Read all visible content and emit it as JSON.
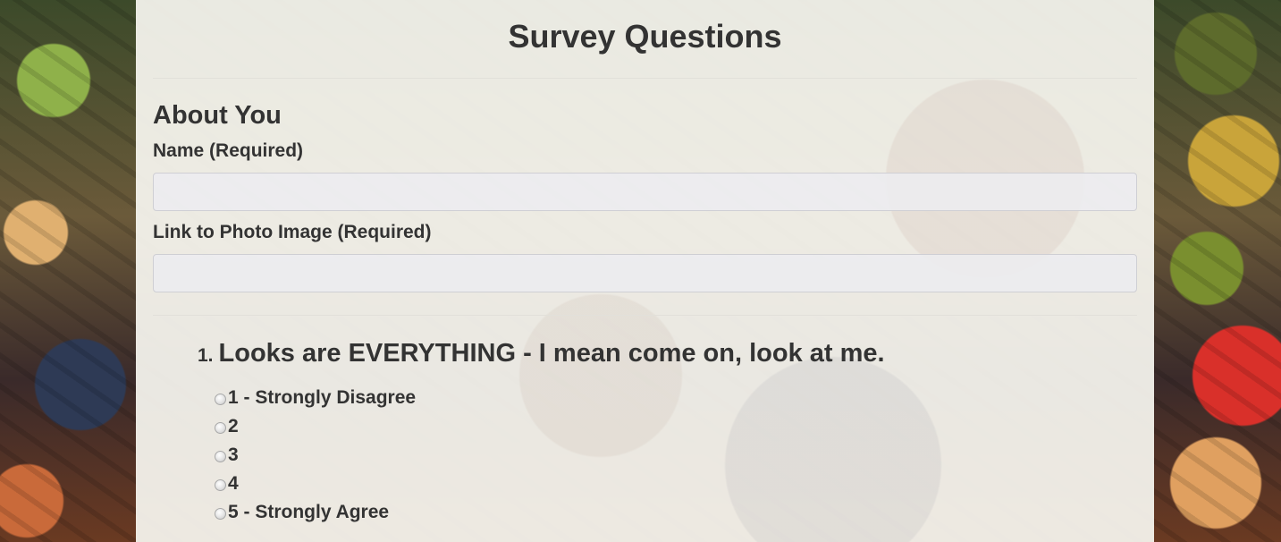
{
  "page": {
    "title": "Survey Questions"
  },
  "about": {
    "heading": "About You",
    "name_label": "Name (Required)",
    "name_value": "",
    "photo_label": "Link to Photo Image (Required)",
    "photo_value": ""
  },
  "questions": [
    {
      "number": "1.",
      "text": "Looks are EVERYTHING - I mean come on, look at me.",
      "options": [
        "1 - Strongly Disagree",
        "2",
        "3",
        "4",
        "5 - Strongly Agree"
      ]
    }
  ],
  "colors": {
    "text": "#333333",
    "panel": "#f8f6f0",
    "input_border": "#cfcfd4"
  }
}
